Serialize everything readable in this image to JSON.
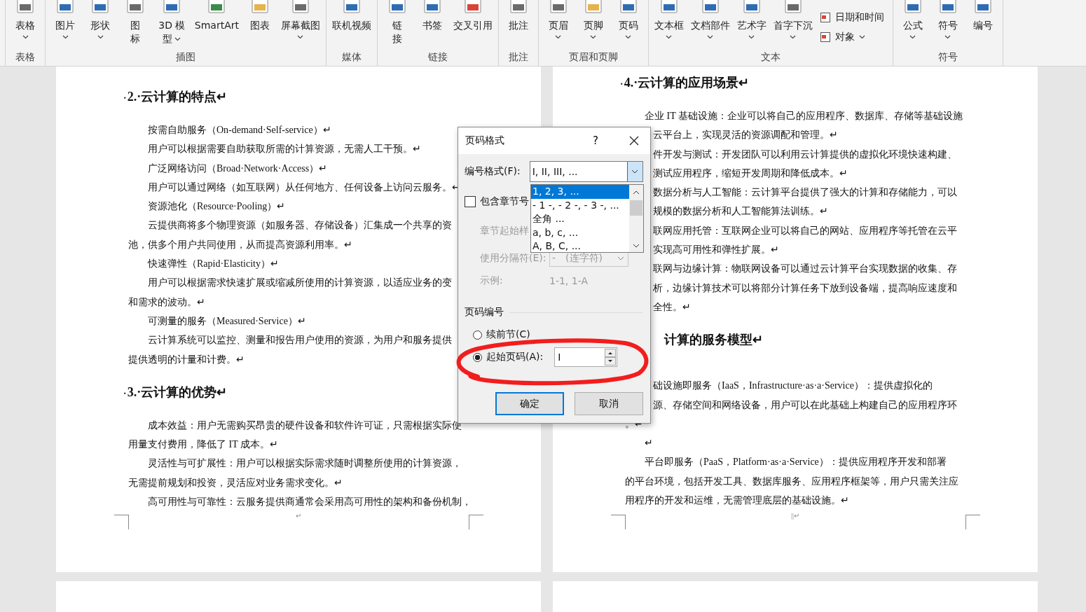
{
  "ribbon": {
    "groups": [
      {
        "label": "表格",
        "items": [
          {
            "label": "表格",
            "dropdown": true
          }
        ]
      },
      {
        "label": "插图",
        "items": [
          {
            "label": "图片",
            "dropdown": true
          },
          {
            "label": "形状",
            "dropdown": true
          },
          {
            "label": "图标",
            "dropdown": false
          },
          {
            "label": "3D 模型",
            "dropdown": true
          },
          {
            "label": "SmartArt",
            "dropdown": false
          },
          {
            "label": "图表",
            "dropdown": false
          },
          {
            "label": "屏幕截图",
            "dropdown": true
          }
        ]
      },
      {
        "label": "媒体",
        "items": [
          {
            "label": "联机视频",
            "dropdown": false
          }
        ]
      },
      {
        "label": "链接",
        "items": [
          {
            "label": "链接",
            "dropdown": false
          },
          {
            "label": "书签",
            "dropdown": false
          },
          {
            "label": "交叉引用",
            "dropdown": false
          }
        ]
      },
      {
        "label": "批注",
        "items": [
          {
            "label": "批注",
            "dropdown": false
          }
        ]
      },
      {
        "label": "页眉和页脚",
        "items": [
          {
            "label": "页眉",
            "dropdown": true
          },
          {
            "label": "页脚",
            "dropdown": true
          },
          {
            "label": "页码",
            "dropdown": true
          }
        ]
      },
      {
        "label": "文本",
        "items": [
          {
            "label": "文本框",
            "dropdown": true
          },
          {
            "label": "文档部件",
            "dropdown": true
          },
          {
            "label": "艺术字",
            "dropdown": true
          },
          {
            "label": "首字下沉",
            "dropdown": true
          }
        ],
        "small_items": [
          {
            "label": "日期和时间",
            "dropdown": false
          },
          {
            "label": "对象",
            "dropdown": true
          }
        ]
      },
      {
        "label": "符号",
        "items": [
          {
            "label": "公式",
            "dropdown": true
          },
          {
            "label": "符号",
            "dropdown": true
          },
          {
            "label": "编号",
            "dropdown": false
          }
        ]
      }
    ]
  },
  "pages": [
    {
      "lines": [
        {
          "kind": "heading",
          "marker": "▪",
          "text": "2.·云计算的特点↵"
        },
        {
          "kind": "first",
          "text": "按需自助服务（On-demand·Self-service）↵"
        },
        {
          "kind": "first",
          "text": "用户可以根据需要自助获取所需的计算资源，无需人工干预。↵"
        },
        {
          "kind": "first",
          "text": "广泛网络访问（Broad·Network·Access）↵"
        },
        {
          "kind": "first",
          "text": "用户可以通过网络（如互联网）从任何地方、任何设备上访问云服务。↵"
        },
        {
          "kind": "first",
          "text": "资源池化（Resource·Pooling）↵"
        },
        {
          "kind": "first",
          "text": "云提供商将多个物理资源（如服务器、存储设备）汇集成一个共享的资"
        },
        {
          "kind": "cont",
          "text": "池，供多个用户共同使用，从而提高资源利用率。↵"
        },
        {
          "kind": "first",
          "text": "快速弹性（Rapid·Elasticity）↵"
        },
        {
          "kind": "first",
          "text": "用户可以根据需求快速扩展或缩减所使用的计算资源，以适应业务的变"
        },
        {
          "kind": "cont",
          "text": "和需求的波动。↵"
        },
        {
          "kind": "first",
          "text": "可测量的服务（Measured·Service）↵"
        },
        {
          "kind": "first",
          "text": "云计算系统可以监控、测量和报告用户使用的资源，为用户和服务提供"
        },
        {
          "kind": "cont",
          "text": "提供透明的计量和计费。↵"
        },
        {
          "kind": "heading",
          "marker": "▪",
          "text": "3.·云计算的优势↵"
        },
        {
          "kind": "first",
          "text": "成本效益：用户无需购买昂贵的硬件设备和软件许可证，只需根据实际使"
        },
        {
          "kind": "cont",
          "text": "用量支付费用，降低了 IT 成本。↵"
        },
        {
          "kind": "first",
          "text": "灵活性与可扩展性：用户可以根据实际需求随时调整所使用的计算资源，"
        },
        {
          "kind": "cont",
          "text": "无需提前规划和投资，灵活应对业务需求变化。↵"
        },
        {
          "kind": "first",
          "text": "高可用性与可靠性：云服务提供商通常会采用高可用性的架构和备份机制，"
        }
      ],
      "footer_mark": "↵"
    },
    {
      "lines": [
        {
          "kind": "heading",
          "marker": "▪",
          "text": "4.·云计算的应用场景↵"
        },
        {
          "kind": "first",
          "text": "企业 IT 基础设施：企业可以将自己的应用程序、数据库、存储等基础设施"
        },
        {
          "kind": "clipped",
          "text": "云平台上，实现灵活的资源调配和管理。↵"
        },
        {
          "kind": "clipped",
          "text": "件开发与测试：开发团队可以利用云计算提供的虚拟化环境快速构建、"
        },
        {
          "kind": "clipped",
          "text": "测试应用程序，缩短开发周期和降低成本。↵"
        },
        {
          "kind": "clipped",
          "text": "数据分析与人工智能：云计算平台提供了强大的计算和存储能力，可以"
        },
        {
          "kind": "clipped",
          "text": "规模的数据分析和人工智能算法训练。↵"
        },
        {
          "kind": "clipped",
          "text": "联网应用托管：互联网企业可以将自己的网站、应用程序等托管在云平"
        },
        {
          "kind": "clipped",
          "text": "实现高可用性和弹性扩展。↵"
        },
        {
          "kind": "clipped",
          "text": "联网与边缘计算：物联网设备可以通过云计算平台实现数据的收集、存"
        },
        {
          "kind": "clipped",
          "text": "析，边缘计算技术可以将部分计算任务下放到设备端，提高响应速度和"
        },
        {
          "kind": "clipped",
          "text": "全性。↵"
        },
        {
          "kind": "heading_clipped",
          "text": "计算的服务模型↵"
        },
        {
          "kind": "clipped",
          "text": "础设施即服务（IaaS，Infrastructure·as·a·Service）：提供虚拟化的"
        },
        {
          "kind": "clipped",
          "text": "源、存储空间和网络设备，用户可以在此基础上构建自己的应用程序环"
        },
        {
          "kind": "cont",
          "text": "。↵"
        },
        {
          "kind": "first",
          "text": "↵"
        },
        {
          "kind": "first",
          "text": "平台即服务（PaaS，Platform·as·a·Service）：提供应用程序开发和部署"
        },
        {
          "kind": "cont",
          "text": "的平台环境，包括开发工具、数据库服务、应用程序框架等，用户只需关注应"
        },
        {
          "kind": "cont",
          "text": "用程序的开发和运维，无需管理底层的基础设施。↵"
        }
      ],
      "footer_mark": "||↵"
    }
  ],
  "dialog": {
    "title": "页码格式",
    "help": "?",
    "format_label": "编号格式(F):",
    "format_value": "I, II, III, ...",
    "format_options": [
      {
        "label": "1, 2, 3, ...",
        "selected": true
      },
      {
        "label": "- 1 -, - 2 -, - 3 -, ...",
        "selected": false
      },
      {
        "label": "全角 ...",
        "selected": false
      },
      {
        "label": "a, b, c, ...",
        "selected": false
      },
      {
        "label": "A, B, C, ...",
        "selected": false
      }
    ],
    "include_chapter": {
      "label": "包含章节号",
      "checked": false
    },
    "chapter_style": {
      "label": "章节起始样",
      "disabled": true
    },
    "separator": {
      "label": "使用分隔符(E):",
      "value": "-　(连字符)",
      "disabled": true
    },
    "example": {
      "label": "示例:",
      "value": "1-1, 1-A",
      "disabled": true
    },
    "numbering_section": "页码编号",
    "radios": [
      {
        "label": "续前节(C)",
        "selected": false
      },
      {
        "label": "起始页码(A):",
        "selected": true
      }
    ],
    "start_value": "I",
    "buttons": [
      {
        "label": "确定",
        "default": true
      },
      {
        "label": "取消",
        "default": false
      }
    ]
  }
}
